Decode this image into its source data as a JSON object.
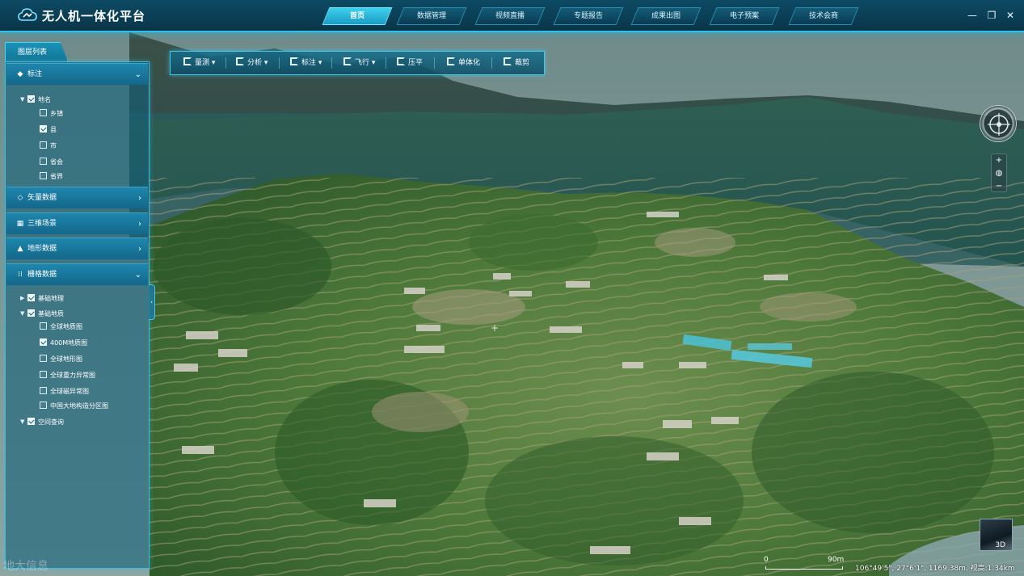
{
  "app": {
    "title": "无人机一体化平台"
  },
  "nav": {
    "tabs": [
      {
        "label": "首页",
        "active": true
      },
      {
        "label": "数据管理",
        "active": false
      },
      {
        "label": "视频直播",
        "active": false
      },
      {
        "label": "专题报告",
        "active": false
      },
      {
        "label": "成果出图",
        "active": false
      },
      {
        "label": "电子预案",
        "active": false
      },
      {
        "label": "技术会商",
        "active": false
      }
    ]
  },
  "window_controls": {
    "minimize": "—",
    "restore": "❐",
    "close": "✕"
  },
  "toolbar": {
    "items": [
      {
        "label": "量测 ▾",
        "icon": "ruler-icon"
      },
      {
        "label": "分析 ▾",
        "icon": "analysis-icon"
      },
      {
        "label": "标注 ▾",
        "icon": "annotation-icon"
      },
      {
        "label": "飞行 ▾",
        "icon": "flight-icon"
      },
      {
        "label": "压平",
        "icon": "flatten-icon"
      },
      {
        "label": "单体化",
        "icon": "monomer-icon"
      },
      {
        "label": "裁剪",
        "icon": "clip-icon"
      }
    ]
  },
  "layer_panel": {
    "tab_label": "图层列表",
    "groups": {
      "annotation": {
        "label": "标注",
        "icon": "tag-icon",
        "expanded": true
      },
      "vector": {
        "label": "矢量数据",
        "icon": "vector-icon",
        "expanded": false
      },
      "scene3d": {
        "label": "三维场景",
        "icon": "scene-icon",
        "expanded": false
      },
      "terrain": {
        "label": "地形数据",
        "icon": "terrain-icon",
        "expanded": false
      },
      "raster": {
        "label": "栅格数据",
        "icon": "grid-icon",
        "expanded": true
      }
    },
    "annotation_tree": {
      "root": {
        "label": "地名",
        "checked": true
      },
      "children": [
        {
          "label": "乡镇",
          "checked": false
        },
        {
          "label": "县",
          "checked": true
        },
        {
          "label": "市",
          "checked": false
        },
        {
          "label": "省会",
          "checked": false
        },
        {
          "label": "省界",
          "checked": false
        }
      ]
    },
    "raster_tree": {
      "basic_geo": {
        "label": "基础地理",
        "checked": true
      },
      "basic_geology": {
        "label": "基础地质",
        "checked": true
      },
      "geology_children": [
        {
          "label": "全球地质图",
          "checked": false
        },
        {
          "label": "400M地质图",
          "checked": true
        },
        {
          "label": "全球地形图",
          "checked": false
        },
        {
          "label": "全球重力异常图",
          "checked": false
        },
        {
          "label": "全球磁异常图",
          "checked": false
        },
        {
          "label": "中国大地构造分区图",
          "checked": false
        }
      ],
      "spatial_query": {
        "label": "空间查询",
        "checked": true
      }
    }
  },
  "map": {
    "zoom_in": "+",
    "zoom_out": "−",
    "mode_label": "3D",
    "scale": {
      "start": "0",
      "end": "90m"
    },
    "coordinates": "106°49'5\", 27°6'1\", 1169.38m, 视高:1.34km",
    "watermark": "地大信息"
  }
}
